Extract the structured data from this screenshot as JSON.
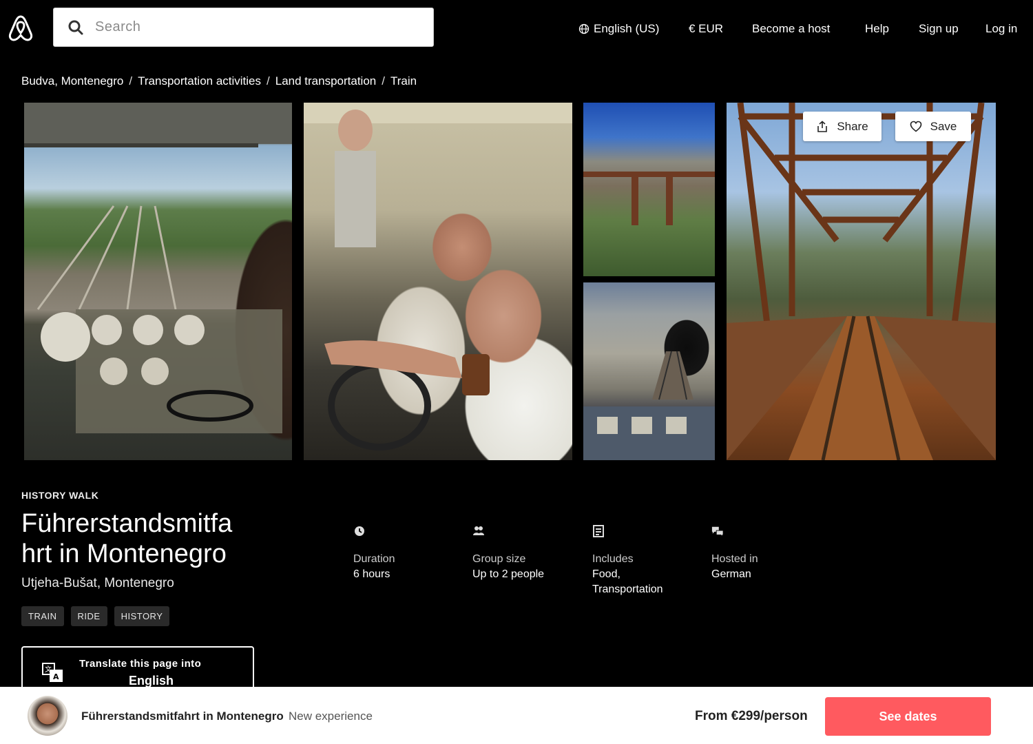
{
  "header": {
    "logo_icon": "airbnb-logo-icon",
    "search_placeholder": "Search",
    "nav": {
      "language": "English (US)",
      "currency": "€ EUR",
      "become_host": "Become a host",
      "help": "Help",
      "sign_up": "Sign up",
      "log_in": "Log in"
    }
  },
  "breadcrumb": [
    "Budva, Montenegro",
    "Transportation activities",
    "Land transportation",
    "Train"
  ],
  "gallery": {
    "share_label": "Share",
    "save_label": "Save"
  },
  "experience": {
    "category": "HISTORY WALK",
    "title": "Führerstandsmitfahrt in Montenegro",
    "title_line1": "Führerstandsmitfa",
    "title_line2": "hrt in Montenegro",
    "location": "Utjeha-Bušat, Montenegro",
    "tags": [
      "TRAIN",
      "RIDE",
      "HISTORY"
    ],
    "translate_line1": "Translate this page into",
    "translate_line2": "English"
  },
  "info": {
    "duration": {
      "icon": "clock-icon",
      "label": "Duration",
      "value": "6 hours"
    },
    "group": {
      "icon": "people-icon",
      "label": "Group size",
      "value": "Up to 2 people"
    },
    "includes": {
      "icon": "receipt-icon",
      "label": "Includes",
      "value": "Food, Transportation"
    },
    "hosted": {
      "icon": "chat-bubbles-icon",
      "label": "Hosted in",
      "value": "German"
    }
  },
  "bottom_bar": {
    "title": "Führerstandsmitfahrt in Montenegro",
    "subtitle": "New experience",
    "price": "From €299",
    "per": "/person",
    "cta": "See dates"
  },
  "colors": {
    "background": "#000000",
    "accent": "#ff5a5f",
    "tag_bg": "#2a2a2a"
  }
}
